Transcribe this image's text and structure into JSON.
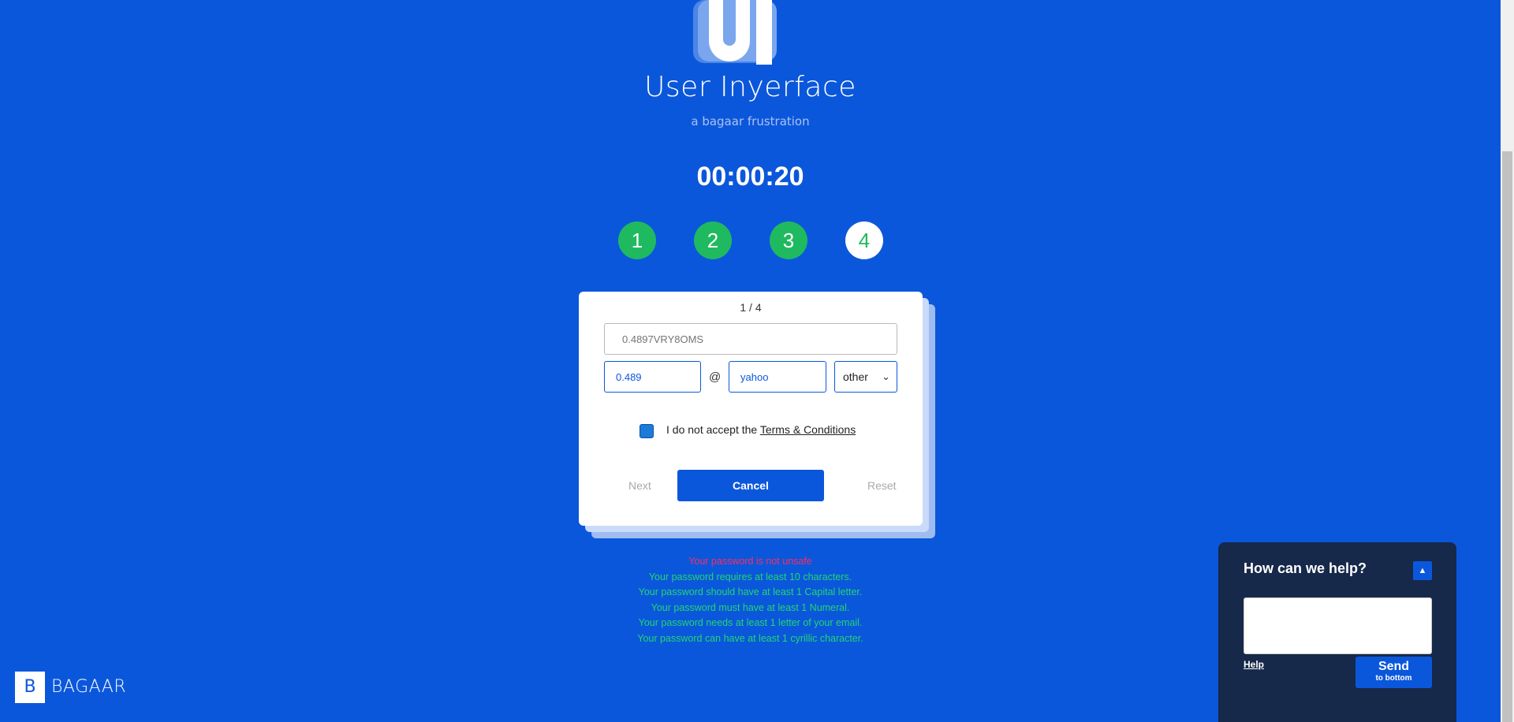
{
  "app": {
    "title": "User Inyerface",
    "subtitle": "a bagaar frustration",
    "logo_text": "UI"
  },
  "timer": "00:00:20",
  "steps": [
    {
      "label": "1",
      "state": "done"
    },
    {
      "label": "2",
      "state": "done"
    },
    {
      "label": "3",
      "state": "done"
    },
    {
      "label": "4",
      "state": "current"
    }
  ],
  "form": {
    "pager": "1 / 4",
    "password_placeholder": "0.4897VRY8OMS",
    "email_name": "0.489",
    "at_symbol": "@",
    "email_domain": "yahoo",
    "tld_selected": "other",
    "checkbox_checked": true,
    "terms_prefix": "I do not accept the ",
    "terms_link": "Terms & Conditions",
    "next_label": "Next",
    "cancel_label": "Cancel",
    "reset_label": "Reset"
  },
  "validation": {
    "error": "Your password is not unsafe",
    "hints": [
      "Your password requires at least 10 characters.",
      "Your password should have at least 1 Capital letter.",
      "Your password must have at least 1 Numeral.",
      "Your password needs at least 1 letter of your email.",
      "Your password can have at least 1 cyrillic character."
    ]
  },
  "brand": {
    "badge_letter": "B",
    "name": "BAGAAR"
  },
  "help_widget": {
    "title": "How can we help?",
    "toggle_icon": "chevron-up-icon",
    "help_link": "Help",
    "send_label": "Send",
    "send_sub": "to bottom"
  },
  "colors": {
    "background": "#0b57dc",
    "step_done": "#1fba5f",
    "error": "#ff2b5e",
    "hint": "#22d66e",
    "help_bg": "#16294a"
  }
}
